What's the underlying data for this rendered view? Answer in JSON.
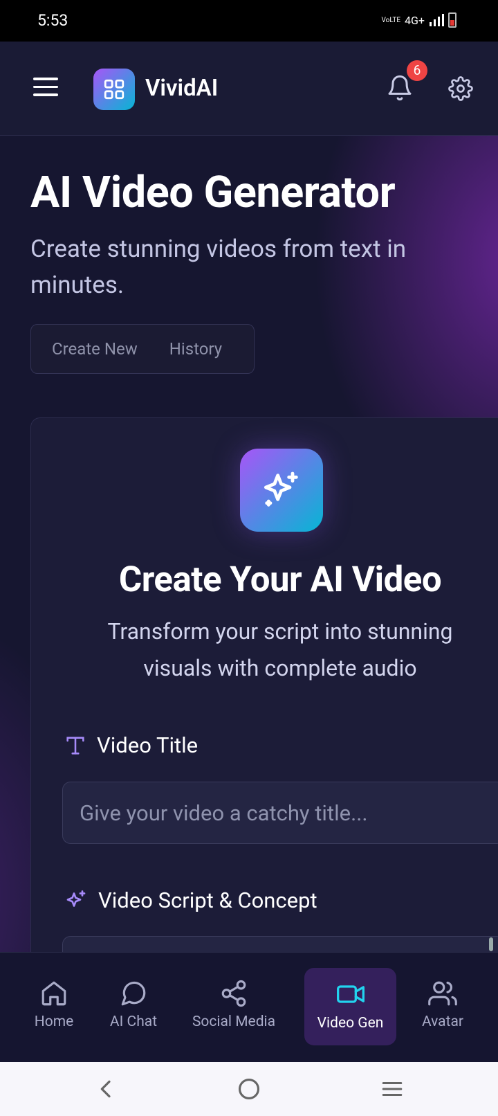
{
  "status_bar": {
    "time": "5:53",
    "network": "4G+",
    "volte": "VoLTE"
  },
  "app_bar": {
    "brand": "VividAI",
    "notification_count": "6"
  },
  "hero": {
    "title": "AI Video Generator",
    "subtitle": "Create stunning videos from text in minutes.",
    "tabs": [
      {
        "label": "Create New"
      },
      {
        "label": "History"
      }
    ]
  },
  "card": {
    "title": "Create Your AI Video",
    "subtitle": "Transform your script into stunning visuals with complete audio",
    "fields": {
      "title": {
        "label": "Video Title",
        "placeholder": "Give your video a catchy title..."
      },
      "script": {
        "label": "Video Script & Concept"
      }
    }
  },
  "bottom_nav": {
    "items": [
      {
        "label": "Home",
        "icon": "home-icon"
      },
      {
        "label": "AI Chat",
        "icon": "chat-icon"
      },
      {
        "label": "Social Media",
        "icon": "share-icon"
      },
      {
        "label": "Video Gen",
        "icon": "video-icon",
        "active": true
      },
      {
        "label": "Avatar",
        "icon": "users-icon"
      }
    ]
  },
  "colors": {
    "accent_gradient_start": "#a855f7",
    "accent_gradient_end": "#06b6d4",
    "badge": "#ef4444",
    "active_nav_bg": "#34205c"
  }
}
